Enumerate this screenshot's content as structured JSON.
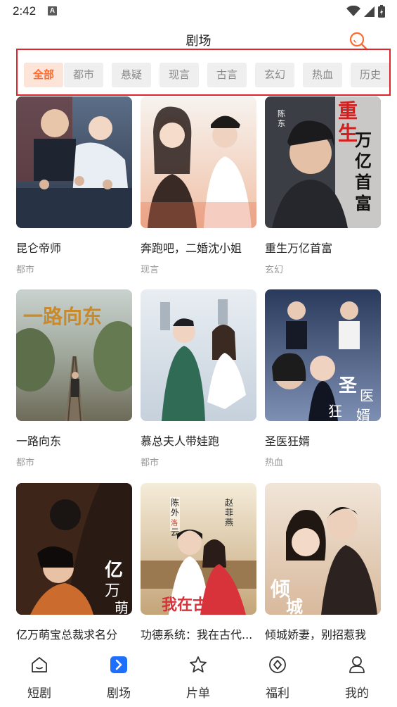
{
  "status_bar": {
    "time": "2:42",
    "notification_badge": "A"
  },
  "header": {
    "title": "剧场",
    "search_icon": "search-icon"
  },
  "filters": {
    "active_color": "#ff6a2e",
    "items": [
      {
        "label": "全部",
        "active": true
      },
      {
        "label": "都市",
        "active": false
      },
      {
        "label": "悬疑",
        "active": false
      },
      {
        "label": "现言",
        "active": false
      },
      {
        "label": "古言",
        "active": false
      },
      {
        "label": "玄幻",
        "active": false
      },
      {
        "label": "热血",
        "active": false
      },
      {
        "label": "历史",
        "active": false
      }
    ]
  },
  "dramas": [
    {
      "title": "昆仑帝师",
      "genre": "都市"
    },
    {
      "title": "奔跑吧，二婚沈小姐",
      "genre": "现言"
    },
    {
      "title": "重生万亿首富",
      "genre": "玄幻",
      "poster_text": [
        "陈",
        "东",
        "重",
        "生",
        "万",
        "亿",
        "首",
        "富"
      ]
    },
    {
      "title": "一路向东",
      "genre": "都市",
      "poster_text": [
        "一路向东"
      ]
    },
    {
      "title": "慕总夫人带娃跑",
      "genre": "都市"
    },
    {
      "title": "圣医狂婿",
      "genre": "热血",
      "poster_text": [
        "圣",
        "医",
        "狂",
        "婿"
      ]
    },
    {
      "title": "亿万萌宝总裁求名分",
      "genre": "",
      "poster_text": [
        "亿",
        "万",
        "萌"
      ]
    },
    {
      "title": "功德系统：我在古代...",
      "genre": "",
      "poster_text": [
        "陈",
        "外",
        "洛",
        "云",
        "赵",
        "菲",
        "燕",
        "我在古代"
      ]
    },
    {
      "title": "倾城娇妻，别招惹我",
      "genre": "",
      "poster_text": [
        "倾",
        "城"
      ]
    }
  ],
  "tab_bar": {
    "items": [
      {
        "label": "短剧",
        "icon": "home-icon",
        "active": false
      },
      {
        "label": "剧场",
        "icon": "theater-icon",
        "active": true
      },
      {
        "label": "片单",
        "icon": "star-icon",
        "active": false
      },
      {
        "label": "福利",
        "icon": "gift-icon",
        "active": false
      },
      {
        "label": "我的",
        "icon": "user-icon",
        "active": false
      }
    ],
    "active_color": "#1f6fff"
  }
}
